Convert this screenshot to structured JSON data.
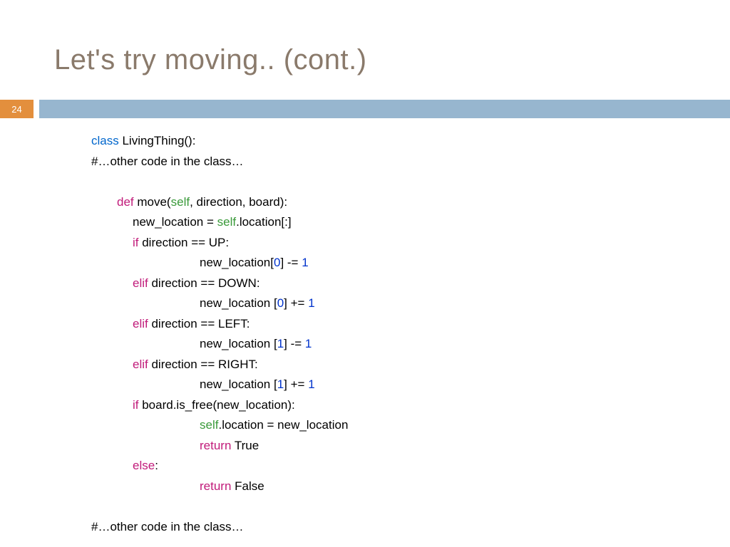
{
  "title": "Let's try moving.. (cont.)",
  "page_number": "24",
  "code": {
    "kw": {
      "class": "class",
      "def": "def",
      "self": "self",
      "if": "if",
      "elif": "elif",
      "else": "else",
      "return": "return"
    },
    "n0": "0",
    "n1": "1",
    "l1_rest": " LivingThing():",
    "l2": "#…other code in the class…",
    "l4_rest": " move(",
    "l4_rest2": ", direction, board):",
    "l5_a": "new_location = ",
    "l5_b": ".location[:]",
    "l6_rest": " direction == UP:",
    "l7_a": "new_location[",
    "l7_b": "] -= ",
    "l8_rest": " direction == DOWN:",
    "l9_a": "new_location [",
    "l9_b": "] += ",
    "l10_rest": " direction == LEFT:",
    "l11_a": "new_location [",
    "l11_b": "] -= ",
    "l12_rest": " direction == RIGHT:",
    "l13_a": "new_location [",
    "l13_b": "] += ",
    "l14_rest": " board.is_free(new_location):",
    "l15_b": ".location = new_location",
    "l16_rest": " True",
    "l17_rest": ":",
    "l18_rest": " False",
    "l20": "#…other code in the class…"
  }
}
